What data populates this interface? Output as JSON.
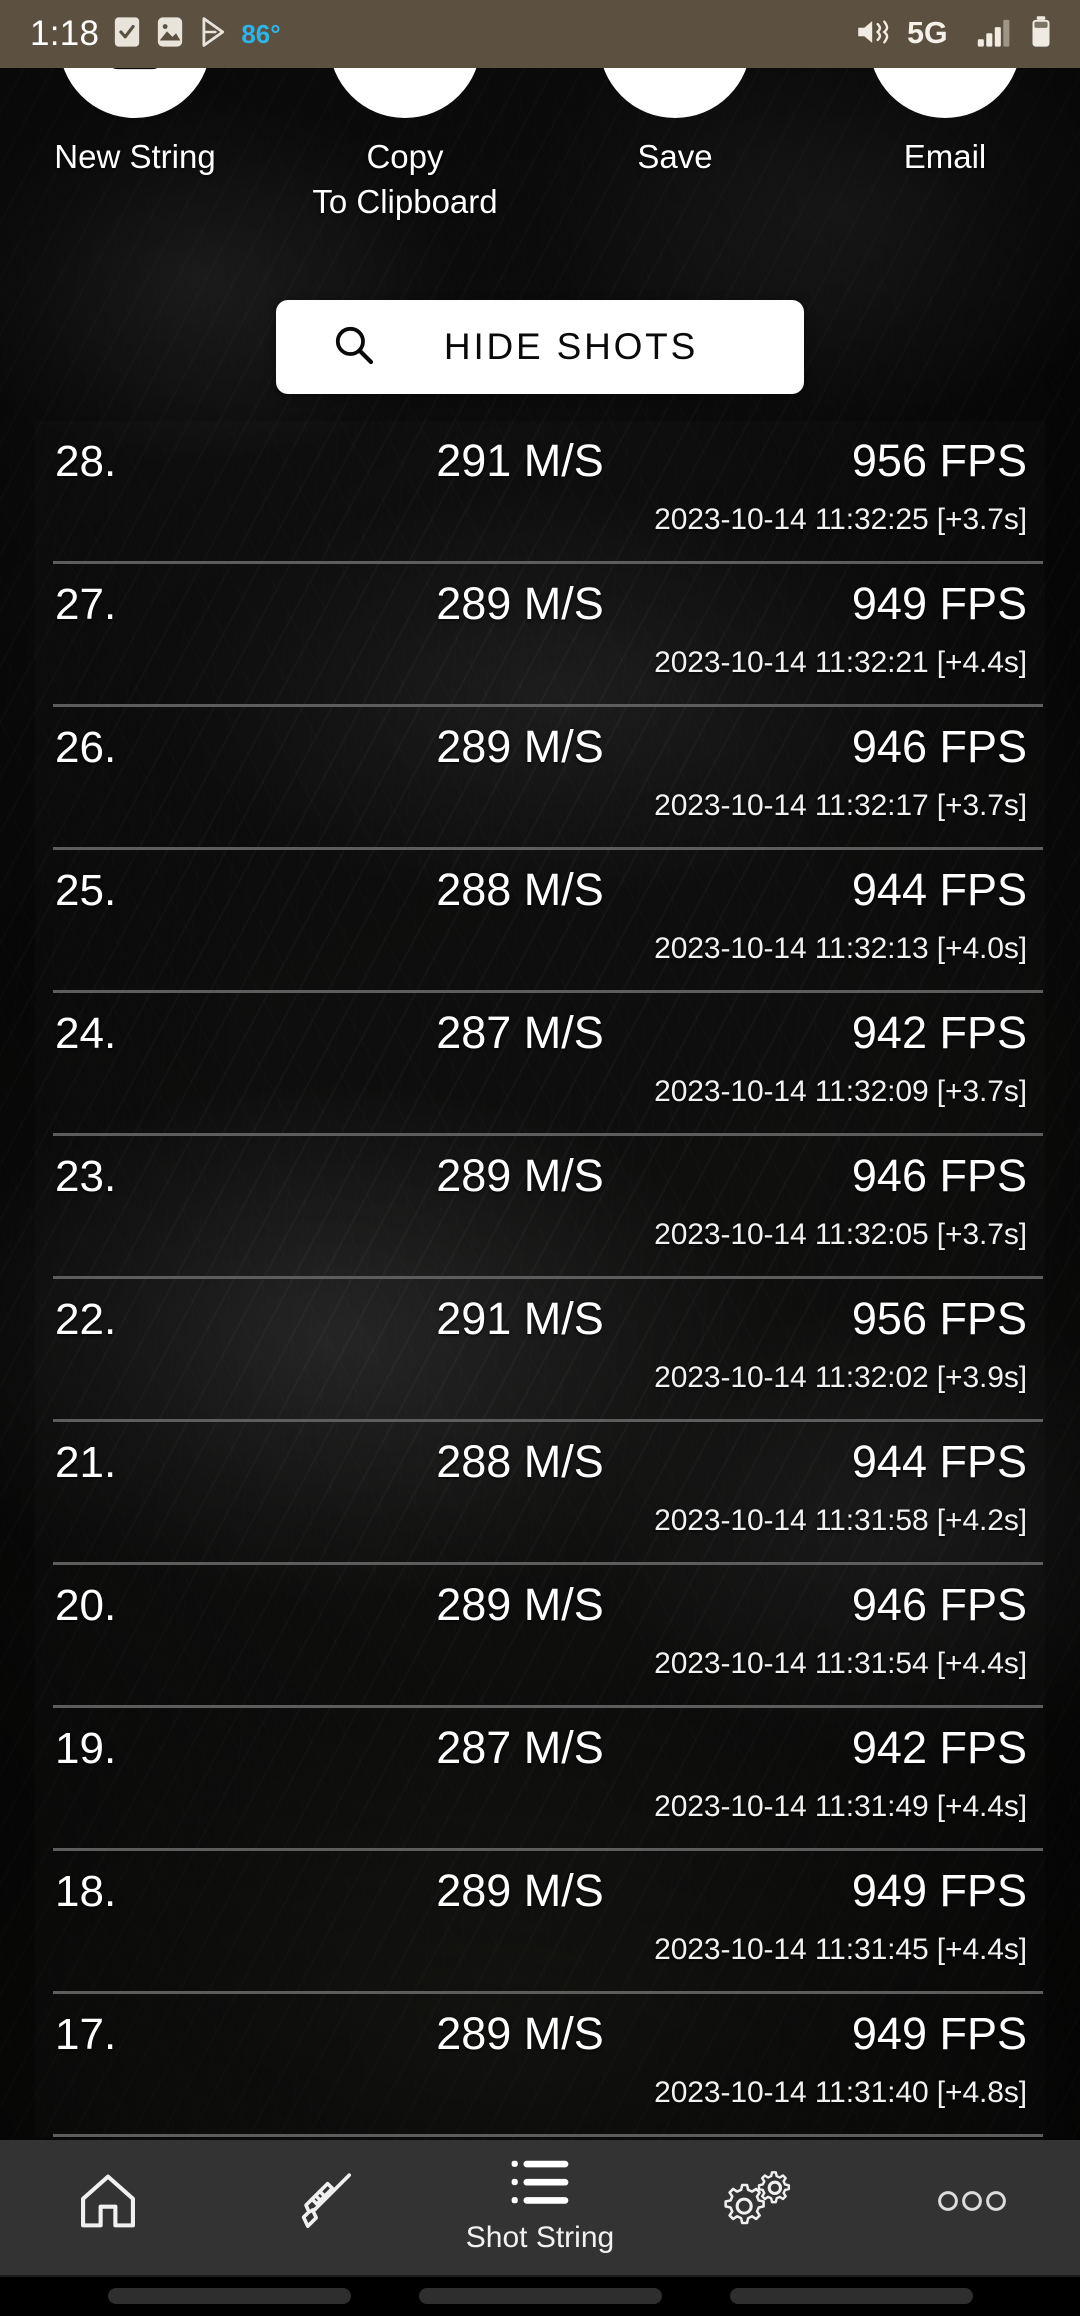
{
  "status_bar": {
    "time": "1:18",
    "temperature": "86°",
    "network": "5G",
    "icons_left": [
      "task-check-icon",
      "gallery-icon",
      "play-store-icon"
    ],
    "icons_right": [
      "mute-icon",
      "signal-bars-icon",
      "battery-icon"
    ]
  },
  "actions": [
    {
      "id": "new-string",
      "label": "New String",
      "icon": "plus-square-icon"
    },
    {
      "id": "copy",
      "label": "Copy\nTo Clipboard",
      "icon": "copy-icon"
    },
    {
      "id": "save",
      "label": "Save",
      "icon": "download-icon"
    },
    {
      "id": "email",
      "label": "Email",
      "icon": "envelope-icon"
    }
  ],
  "hide_shots": {
    "label": "HIDE SHOTS",
    "icon": "search-icon"
  },
  "shots": [
    {
      "index": "28.",
      "speed": "291 M/S",
      "fps": "956 FPS",
      "stamp": "2023-10-14 11:32:25 [+3.7s]"
    },
    {
      "index": "27.",
      "speed": "289 M/S",
      "fps": "949 FPS",
      "stamp": "2023-10-14 11:32:21 [+4.4s]"
    },
    {
      "index": "26.",
      "speed": "289 M/S",
      "fps": "946 FPS",
      "stamp": "2023-10-14 11:32:17 [+3.7s]"
    },
    {
      "index": "25.",
      "speed": "288 M/S",
      "fps": "944 FPS",
      "stamp": "2023-10-14 11:32:13 [+4.0s]"
    },
    {
      "index": "24.",
      "speed": "287 M/S",
      "fps": "942 FPS",
      "stamp": "2023-10-14 11:32:09 [+3.7s]"
    },
    {
      "index": "23.",
      "speed": "289 M/S",
      "fps": "946 FPS",
      "stamp": "2023-10-14 11:32:05 [+3.7s]"
    },
    {
      "index": "22.",
      "speed": "291 M/S",
      "fps": "956 FPS",
      "stamp": "2023-10-14 11:32:02 [+3.9s]"
    },
    {
      "index": "21.",
      "speed": "288 M/S",
      "fps": "944 FPS",
      "stamp": "2023-10-14 11:31:58 [+4.2s]"
    },
    {
      "index": "20.",
      "speed": "289 M/S",
      "fps": "946 FPS",
      "stamp": "2023-10-14 11:31:54 [+4.4s]"
    },
    {
      "index": "19.",
      "speed": "287 M/S",
      "fps": "942 FPS",
      "stamp": "2023-10-14 11:31:49 [+4.4s]"
    },
    {
      "index": "18.",
      "speed": "289 M/S",
      "fps": "949 FPS",
      "stamp": "2023-10-14 11:31:45 [+4.4s]"
    },
    {
      "index": "17.",
      "speed": "289 M/S",
      "fps": "949 FPS",
      "stamp": "2023-10-14 11:31:40 [+4.8s]"
    }
  ],
  "bottom_nav": [
    {
      "id": "home",
      "label": "",
      "icon": "home-icon"
    },
    {
      "id": "rifle",
      "label": "",
      "icon": "rifle-icon"
    },
    {
      "id": "shot-string",
      "label": "Shot String",
      "icon": "list-icon"
    },
    {
      "id": "settings",
      "label": "",
      "icon": "gears-icon"
    },
    {
      "id": "more",
      "label": "",
      "icon": "more-dots-icon"
    }
  ],
  "colors": {
    "status_bar_bg": "#5c5141",
    "temperature": "#2fb3e8",
    "nav_bg": "#333333",
    "accent_white": "#ffffff",
    "divider": "#5d5d5d"
  }
}
